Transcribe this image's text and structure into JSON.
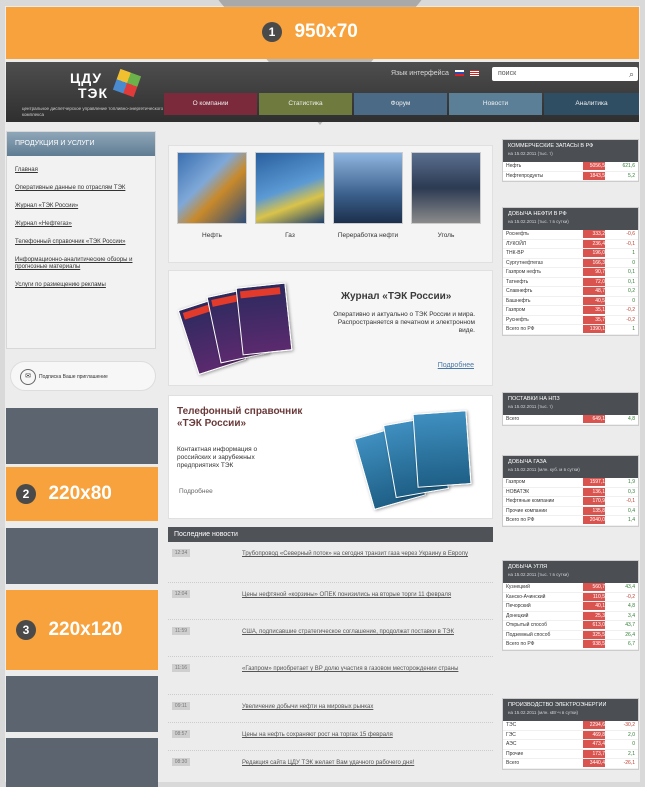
{
  "ads": {
    "top": {
      "num": "1",
      "size": "950x70"
    },
    "side1": {
      "num": "2",
      "size": "220x80"
    },
    "side2": {
      "num": "3",
      "size": "220x120"
    }
  },
  "header": {
    "logo_line1": "ЦДУ",
    "logo_line2": "ТЭК",
    "logo_sub": "центральное диспетчерское управление топливно-энергетического комплекса",
    "lang_label": "Язык интерфейса",
    "search_placeholder": "поиск"
  },
  "nav": [
    {
      "label": "О компании",
      "color": "#7a2a3a"
    },
    {
      "label": "Статистика",
      "color": "#6f7a3f"
    },
    {
      "label": "Форум",
      "color": "#4a6a85"
    },
    {
      "label": "Новости",
      "color": "#5b7f97"
    },
    {
      "label": "Аналитика",
      "color": "#2f4d63"
    }
  ],
  "sidebar": {
    "title": "ПРОДУКЦИЯ И УСЛУГИ",
    "links": [
      "Главная",
      "Оперативные данные по отраслям ТЭК",
      "Журнал «ТЭК России»",
      "Журнал «Нефтегаз»",
      "Телефонный справочник «ТЭК России»",
      "Информационно-аналитические обзоры и прогнозные материалы",
      "Услуги по размещению рекламы"
    ],
    "invite": "Подписка Ваше приглашение"
  },
  "categories": [
    "Нефть",
    "Газ",
    "Переработка нефти",
    "Уголь"
  ],
  "journal": {
    "title": "Журнал «ТЭК России»",
    "desc": "Оперативно и актуально о ТЭК России и мира. Распространяется в печатном и электронном виде.",
    "more": "Подробнее"
  },
  "phonebook": {
    "title": "Телефонный справочник «ТЭК России»",
    "desc": "Контактная информация о российских и зарубежных предприятиях ТЭК",
    "more": "Подробнее"
  },
  "news": {
    "header": "Последние новости",
    "items": [
      {
        "date": "12:34",
        "title": "Трубопровод «Северный поток» на сегодня транзит газа через Украину в Европу"
      },
      {
        "date": "12:04",
        "title": "Цены нефтяной «корзины» ОПЕК понизились на вторые торги 11 февраля"
      },
      {
        "date": "11:59",
        "title": "США, подписавшие стратегическое соглашение, продолжат поставки в ТЭК"
      },
      {
        "date": "11:16",
        "title": "«Газпром» приобретает у ВР долю участия в газовом месторождении страны"
      },
      {
        "date": "09:11",
        "title": "Увеличение добычи нефти на мировых рынках"
      },
      {
        "date": "08:57",
        "title": "Цены на нефть сохраняют рост на торгах 15 февраля"
      },
      {
        "date": "08:30",
        "title": "Редакция сайта ЦДУ ТЭК желает Вам удачного рабочего дня!"
      }
    ]
  },
  "right_widgets": [
    {
      "title": "КОММЕРЧЕСКИЕ ЗАПАСЫ В РФ",
      "sub": "на 15.02.2011 (тыс. т)",
      "rows": [
        [
          "Нефть",
          "5056,5",
          "621,6"
        ],
        [
          "Нефтепродукты",
          "1843,5",
          "5,2"
        ]
      ]
    },
    {
      "title": "ДОБЫЧА НЕФТИ В РФ",
      "sub": "на 15.02.2011 (тыс. т в сутки)",
      "rows": [
        [
          "Роснефть",
          "333,2",
          "-0,6"
        ],
        [
          "ЛУКОЙЛ",
          "236,4",
          "-0,1"
        ],
        [
          "ТНК-ВР",
          "196,0",
          "1"
        ],
        [
          "Сургутнефтегаз",
          "166,3",
          "0"
        ],
        [
          "Газпром нефть",
          "90,7",
          "0,1"
        ],
        [
          "Татнефть",
          "72,0",
          "0,1"
        ],
        [
          "Славнефть",
          "48,7",
          "0,2"
        ],
        [
          "Башнефть",
          "40,5",
          "0"
        ],
        [
          "Газпром",
          "35,1",
          "-0,2"
        ],
        [
          "Руснефть",
          "35,7",
          "-0,2"
        ],
        [
          "Всего по РФ",
          "1390,1",
          "1"
        ]
      ]
    },
    {
      "title": "ПОСТАВКИ НА НПЗ",
      "sub": "на 15.02.2011 (тыс. т)",
      "rows": [
        [
          "Всего",
          "649,1",
          "4,8"
        ]
      ]
    },
    {
      "title": "ДОБЫЧА ГАЗА",
      "sub": "на 15.02.2011 (млн. куб. м в сутки)",
      "rows": [
        [
          "Газпром",
          "1597,1",
          "1,9"
        ],
        [
          "НОВАТЭК",
          "136,1",
          "0,3"
        ],
        [
          "Нефтяные компании",
          "170,9",
          "-0,1"
        ],
        [
          "Прочие компании",
          "135,8",
          "0,4"
        ],
        [
          "Всего по РФ",
          "2040,0",
          "1,4"
        ]
      ]
    },
    {
      "title": "ДОБЫЧА УГЛЯ",
      "sub": "на 15.02.2011 (тыс. т в сутки)",
      "rows": [
        [
          "Кузнецкий",
          "560,7",
          "43,4"
        ],
        [
          "Канско-Ачинский",
          "110,5",
          "-0,2"
        ],
        [
          "Печорский",
          "40,1",
          "4,8"
        ],
        [
          "Донецкий",
          "25,3",
          "3,4"
        ],
        [
          "Открытый способ",
          "613,0",
          "43,7"
        ],
        [
          "Подземный способ",
          "325,5",
          "26,4"
        ],
        [
          "Всего по РФ",
          "938,5",
          "6,7"
        ]
      ]
    },
    {
      "title": "ПРОИЗВОДСТВО ЭЛЕКТРОЭНЕРГИИ",
      "sub": "на 15.02.2011 (млн. кВт-ч в сутки)",
      "rows": [
        [
          "ТЭС",
          "2294,6",
          "-30,2"
        ],
        [
          "ГЭС",
          "469,8",
          "2,0"
        ],
        [
          "АЭС",
          "473,4",
          "0"
        ],
        [
          "Прочие",
          "173,7",
          "2,1"
        ],
        [
          "Всего",
          "3440,4",
          "-26,1"
        ]
      ]
    }
  ]
}
